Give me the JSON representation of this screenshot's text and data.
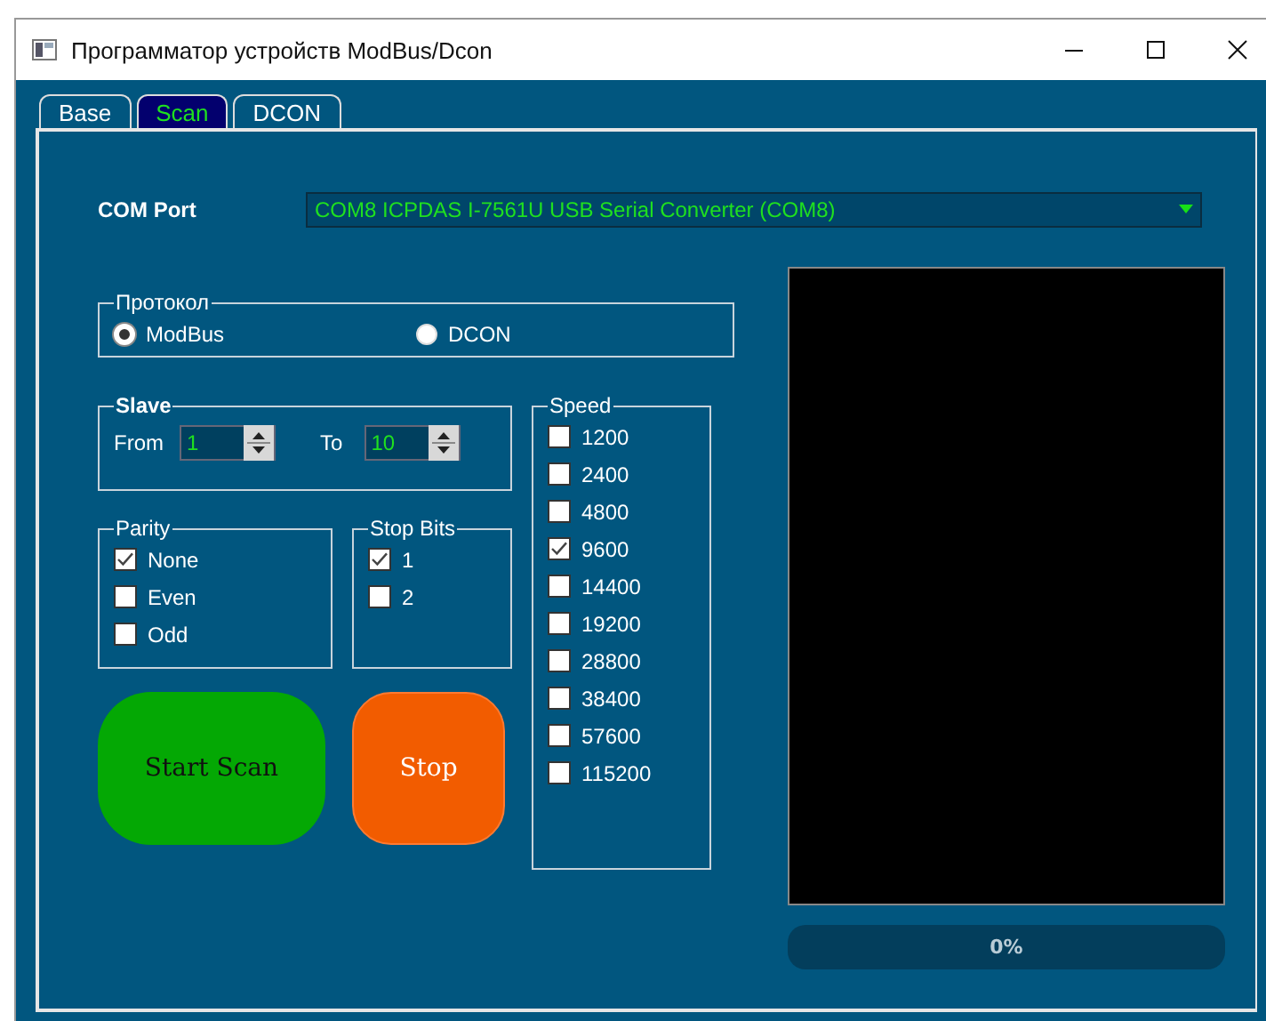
{
  "window": {
    "title": "Программатор устройств ModBus/Dcon"
  },
  "tabs": [
    {
      "label": "Base",
      "selected": false
    },
    {
      "label": "Scan",
      "selected": true
    },
    {
      "label": "DCON",
      "selected": false
    }
  ],
  "com_port": {
    "label": "COM Port",
    "value": "COM8 ICPDAS I-7561U USB Serial Converter (COM8)"
  },
  "protocol": {
    "title": "Протокол",
    "options": [
      {
        "label": "ModBus",
        "selected": true
      },
      {
        "label": "DCON",
        "selected": false
      }
    ]
  },
  "slave": {
    "title": "Slave",
    "from_label": "From",
    "from_value": "1",
    "to_label": "To",
    "to_value": "10"
  },
  "parity": {
    "title": "Parity",
    "options": [
      {
        "label": "None",
        "checked": true
      },
      {
        "label": "Even",
        "checked": false
      },
      {
        "label": "Odd",
        "checked": false
      }
    ]
  },
  "stop_bits": {
    "title": "Stop Bits",
    "options": [
      {
        "label": "1",
        "checked": true
      },
      {
        "label": "2",
        "checked": false
      }
    ]
  },
  "speed": {
    "title": "Speed",
    "options": [
      {
        "label": "1200",
        "checked": false
      },
      {
        "label": "2400",
        "checked": false
      },
      {
        "label": "4800",
        "checked": false
      },
      {
        "label": "9600",
        "checked": true
      },
      {
        "label": "14400",
        "checked": false
      },
      {
        "label": "19200",
        "checked": false
      },
      {
        "label": "28800",
        "checked": false
      },
      {
        "label": "38400",
        "checked": false
      },
      {
        "label": "57600",
        "checked": false
      },
      {
        "label": "115200",
        "checked": false
      }
    ]
  },
  "buttons": [
    {
      "label": "Start Scan",
      "kind": "start"
    },
    {
      "label": "Stop",
      "kind": "stop"
    }
  ],
  "progress": {
    "level": 0,
    "text": "0%"
  }
}
